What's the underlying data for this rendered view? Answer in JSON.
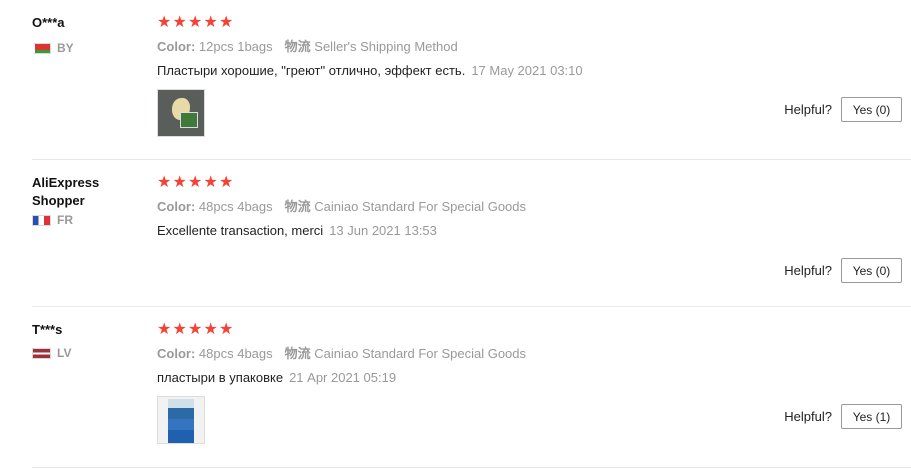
{
  "reviews": [
    {
      "user": "O***a",
      "country": "BY",
      "stars": "★★★★★",
      "color_label": "Color:",
      "color_value": "12pcs 1bags",
      "shipping_label": "物流",
      "shipping_value": "Seller's Shipping Method",
      "text": "Пластыри хорошие, \"греют\" отлично, эффект есть.",
      "date": "17 May 2021 03:10",
      "has_photo": true,
      "helpful_label": "Helpful?",
      "yes_label": "Yes (0)"
    },
    {
      "user": "AliExpress Shopper",
      "country": "FR",
      "stars": "★★★★★",
      "color_label": "Color:",
      "color_value": "48pcs 4bags",
      "shipping_label": "物流",
      "shipping_value": "Cainiao Standard For Special Goods",
      "text": "Excellente transaction, merci",
      "date": "13 Jun 2021 13:53",
      "has_photo": false,
      "helpful_label": "Helpful?",
      "yes_label": "Yes (0)"
    },
    {
      "user": "T***s",
      "country": "LV",
      "stars": "★★★★★",
      "color_label": "Color:",
      "color_value": "48pcs 4bags",
      "shipping_label": "物流",
      "shipping_value": "Cainiao Standard For Special Goods",
      "text": "пластыри в упаковке",
      "date": "21 Apr 2021 05:19",
      "has_photo": true,
      "helpful_label": "Helpful?",
      "yes_label": "Yes (1)"
    }
  ],
  "rating_color": "#f44336",
  "icons": {
    "star": "star-icon",
    "flag_by": "belarus-flag-icon",
    "flag_fr": "france-flag-icon",
    "flag_lv": "latvia-flag-icon"
  }
}
